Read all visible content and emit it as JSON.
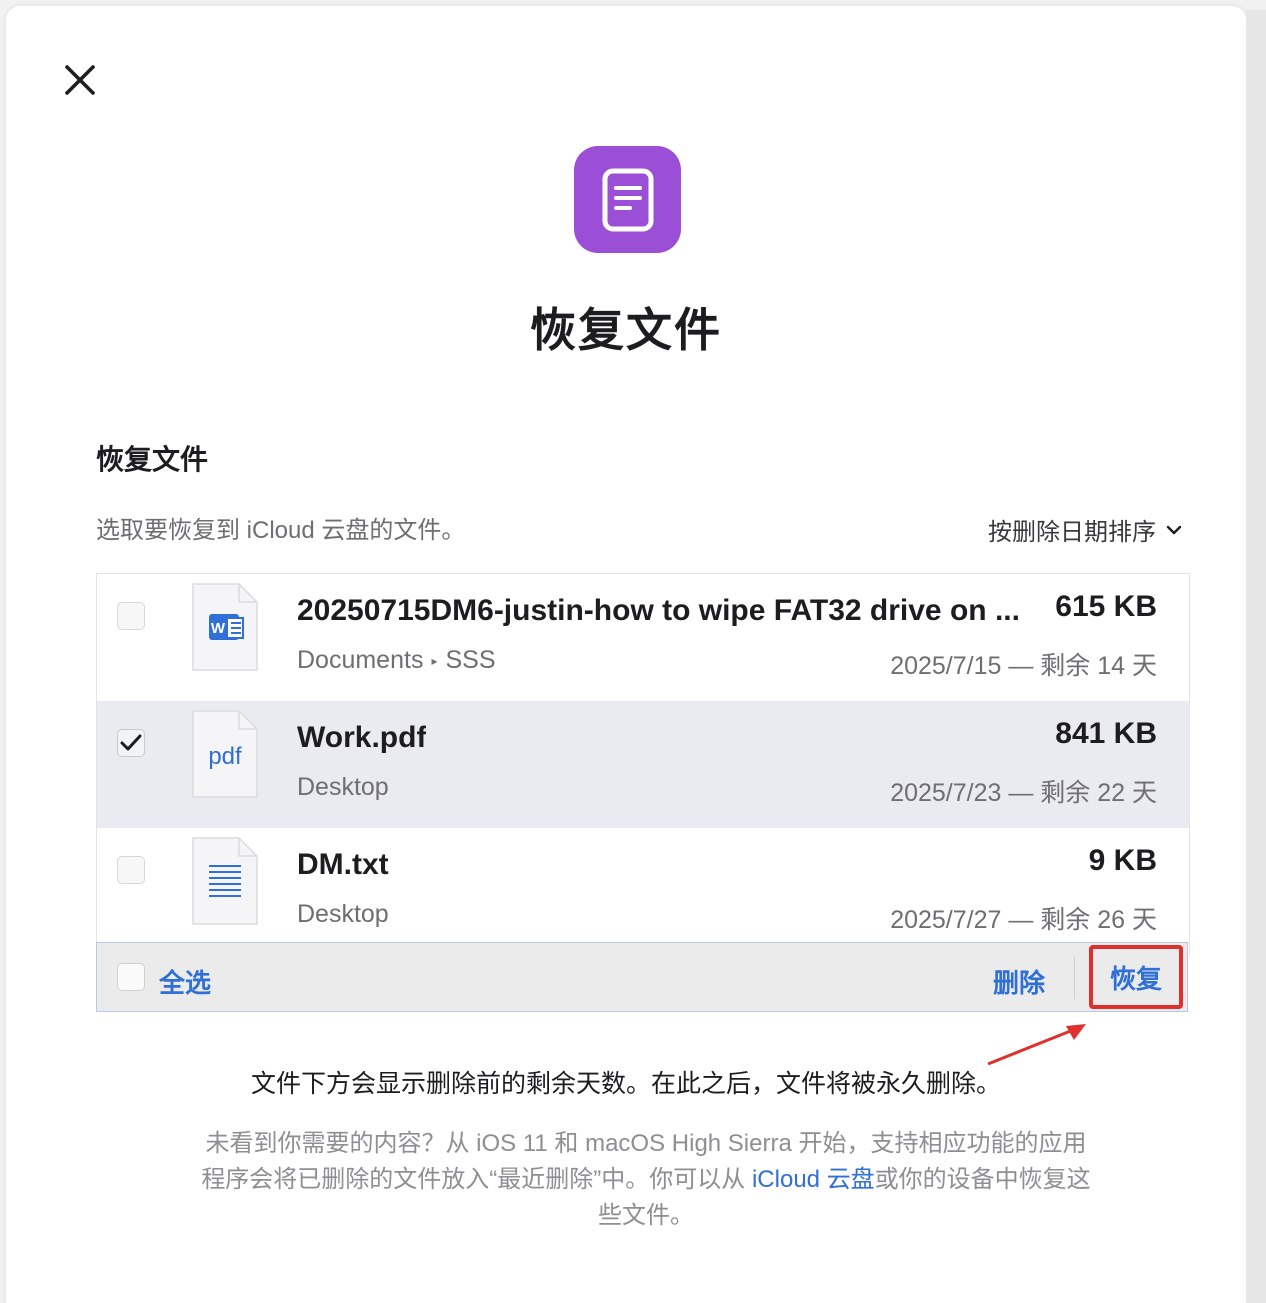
{
  "page": {
    "main_title": "恢复文件",
    "section_title": "恢复文件",
    "subtitle": "选取要恢复到 iCloud 云盘的文件。",
    "sort_label": "按删除日期排序"
  },
  "files": [
    {
      "name": "20250715DM6-justin-how to wipe FAT32 drive on ...",
      "size": "615 KB",
      "path": [
        "Documents",
        "SSS"
      ],
      "date": "2025/7/15 — 剩余 14 天",
      "type": "word",
      "icon_text": "W",
      "selected": false
    },
    {
      "name": "Work.pdf",
      "size": "841 KB",
      "path": [
        "Desktop"
      ],
      "date": "2025/7/23 — 剩余 22 天",
      "type": "pdf",
      "icon_text": "pdf",
      "selected": true
    },
    {
      "name": "DM.txt",
      "size": "9 KB",
      "path": [
        "Desktop"
      ],
      "date": "2025/7/27 — 剩余 26 天",
      "type": "text",
      "icon_text": "",
      "selected": false
    }
  ],
  "actions": {
    "select_all": "全选",
    "delete": "删除",
    "restore": "恢复"
  },
  "notes": {
    "info": "文件下方会显示删除前的剩余天数。在此之后，文件将被永久删除。",
    "help_before": "未看到你需要的内容？从 iOS 11 和 macOS High Sierra 开始，支持相应功能的应用程序会将已删除的文件放入“最近删除”中。你可以从 ",
    "help_link": "iCloud 云盘",
    "help_after": "或你的设备中恢复这些文件。"
  },
  "colors": {
    "app_icon": "#9b4fd6",
    "accent": "#2f6fd6",
    "highlight": "#e0302e",
    "selected_row": "#e9ebf0"
  },
  "icons": {
    "close": "close-icon",
    "app": "document-icon",
    "sort": "chevron-down-icon",
    "check": "checkmark-icon"
  }
}
